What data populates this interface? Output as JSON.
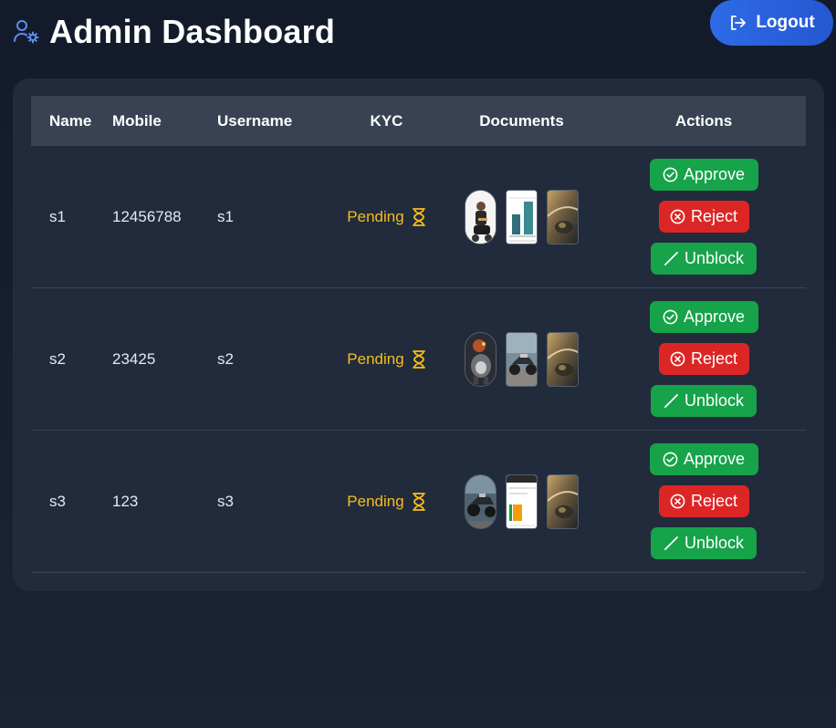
{
  "header": {
    "title": "Admin Dashboard",
    "title_icon": "user-gear-icon",
    "logout_label": "Logout",
    "logout_icon": "logout-icon"
  },
  "table": {
    "columns": [
      "Name",
      "Mobile",
      "Username",
      "KYC",
      "Documents",
      "Actions"
    ],
    "rows": [
      {
        "name": "s1",
        "mobile": "12456788",
        "username": "s1",
        "kyc": "Pending",
        "documents": [
          "photo-man-scooter",
          "chart-screenshot",
          "bike-headlight"
        ],
        "actions": {
          "approve": "Approve",
          "reject": "Reject",
          "unblock": "Unblock"
        }
      },
      {
        "name": "s2",
        "mobile": "23425",
        "username": "s2",
        "kyc": "Pending",
        "documents": [
          "cartoon-character",
          "motorcycle-road",
          "bike-headlight"
        ],
        "actions": {
          "approve": "Approve",
          "reject": "Reject",
          "unblock": "Unblock"
        }
      },
      {
        "name": "s3",
        "mobile": "123",
        "username": "s3",
        "kyc": "Pending",
        "documents": [
          "motorcycle-night",
          "app-screenshot",
          "bike-headlight"
        ],
        "actions": {
          "approve": "Approve",
          "reject": "Reject",
          "unblock": "Unblock"
        }
      }
    ]
  },
  "colors": {
    "background": "#1b2334",
    "card": "#212b3c",
    "table_header": "#384253",
    "pending": "#f5bd1e",
    "approve": "#16a34a",
    "reject": "#dc2626",
    "logout": "#2e6be6",
    "accent_icon": "#5b8def"
  }
}
